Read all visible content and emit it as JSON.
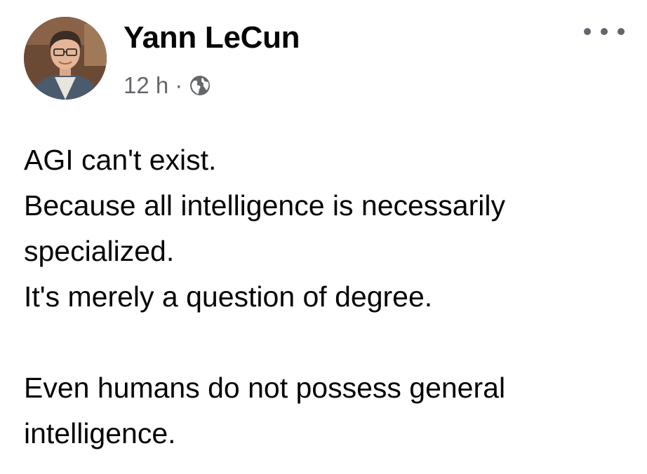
{
  "post": {
    "author": "Yann LeCun",
    "timestamp": "12 h",
    "separator": "·",
    "audience_icon": "globe-icon",
    "more_icon": "more-options-icon",
    "text_lines": [
      "AGI can't exist.",
      "Because all intelligence is necessarily",
      "specialized.",
      "It's merely a question of degree.",
      "",
      "Even humans do not possess general",
      "intelligence."
    ]
  },
  "colors": {
    "text_primary": "#050505",
    "text_secondary": "#65676b",
    "icon_gray": "#606770"
  }
}
